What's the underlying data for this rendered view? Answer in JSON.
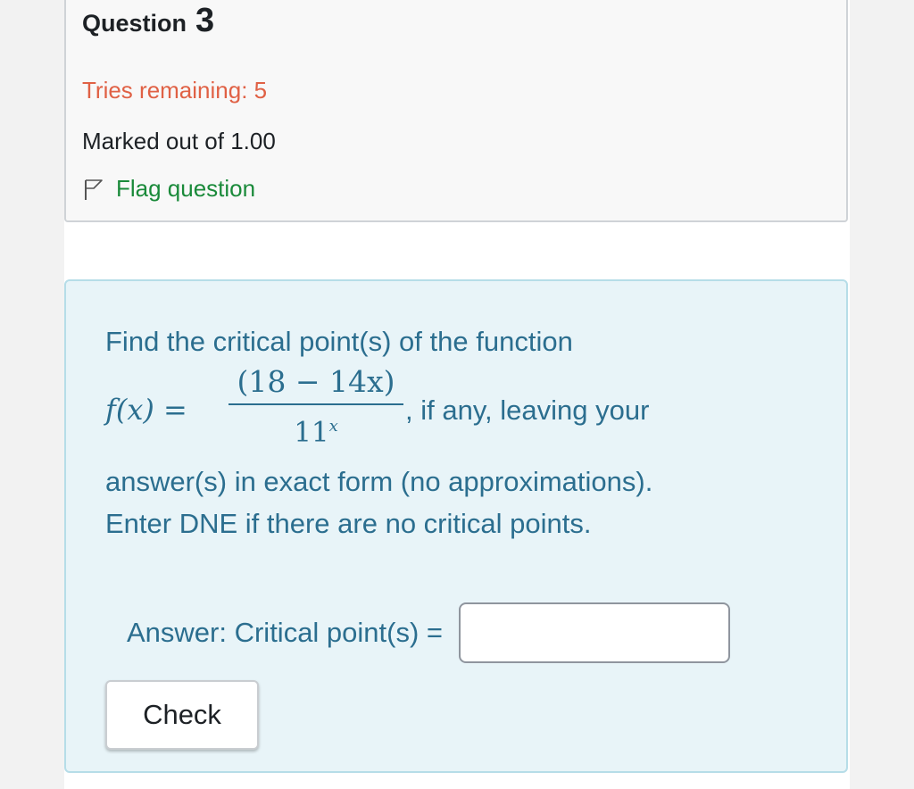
{
  "question": {
    "label": "Question",
    "number": "3",
    "tries": "Tries remaining: 5",
    "marked": "Marked out of 1.00",
    "flag_label": "Flag question"
  },
  "content": {
    "intro": "Find the critical point(s) of the function",
    "fx": "f(x) =",
    "numerator": "(18 − 14x)",
    "denominator_base": "11",
    "denominator_exp": "x",
    "after_fraction": ", if any, leaving your",
    "rest_1": "answer(s) in exact form (no approximations).",
    "rest_2": "Enter DNE if there are no critical points."
  },
  "answer": {
    "label": "Answer: Critical point(s) =",
    "value": "",
    "check_label": "Check"
  },
  "colors": {
    "accent_text": "#2b6e8f",
    "tries": "#e06145",
    "flag": "#1a8a3a",
    "content_bg": "#e8f4f8"
  },
  "icons": {
    "flag": "flag-outline-icon"
  }
}
